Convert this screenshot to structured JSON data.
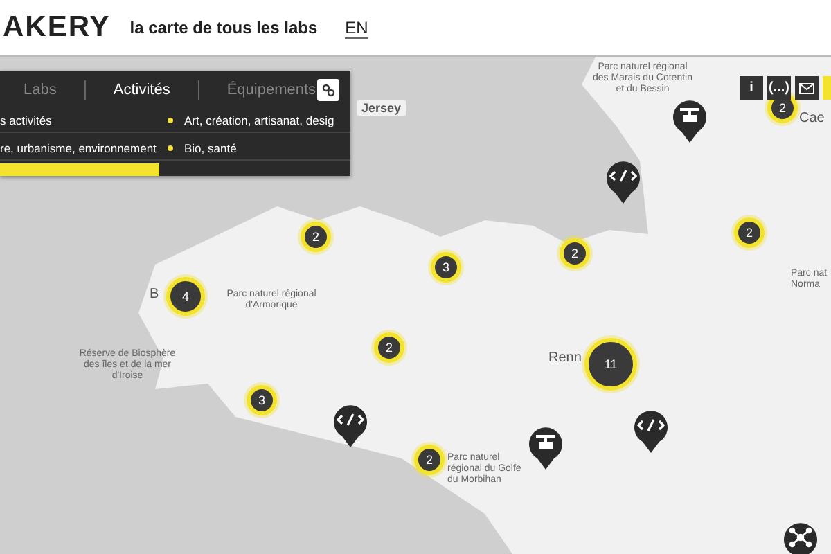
{
  "header": {
    "logo": "AKERY",
    "tagline": "la carte de tous les labs",
    "language": "EN"
  },
  "panel": {
    "tabs": [
      {
        "label": "Labs",
        "selected": false
      },
      {
        "label": "Activités",
        "selected": true
      },
      {
        "label": "Équipements",
        "selected": false
      }
    ],
    "filters": [
      {
        "label": "s activités",
        "dot": false
      },
      {
        "label": "Art, création, artisanat, desig",
        "dot": true
      },
      {
        "label": "re, urbanisme, environnement",
        "dot": false
      },
      {
        "label": "Bio, santé",
        "dot": true
      }
    ]
  },
  "map_tools": [
    {
      "kind": "text",
      "label": "i"
    },
    {
      "kind": "text",
      "label": "(...)"
    },
    {
      "kind": "mail"
    },
    {
      "kind": "blank"
    }
  ],
  "map_labels": [
    {
      "text": "Parc naturel régional des Marais du Cotentin et du Bessin"
    },
    {
      "text": "Jersey"
    },
    {
      "text": "Cae"
    },
    {
      "text": "Parc nat Norma"
    },
    {
      "text": "B"
    },
    {
      "text": "Parc naturel régional d'Armorique"
    },
    {
      "text": "Renn"
    },
    {
      "text": "Réserve de Biosphère des îles et de la mer d'Iroise"
    },
    {
      "text": "Parc naturel régional du Golfe du Morbihan"
    }
  ],
  "clusters": [
    {
      "count": "2"
    },
    {
      "count": "2"
    },
    {
      "count": "3"
    },
    {
      "count": "2"
    },
    {
      "count": "2"
    },
    {
      "count": "4"
    },
    {
      "count": "2"
    },
    {
      "count": "11"
    },
    {
      "count": "3"
    },
    {
      "count": "2"
    }
  ],
  "pins": [
    {
      "kind": "printer"
    },
    {
      "kind": "code"
    },
    {
      "kind": "code"
    },
    {
      "kind": "printer"
    },
    {
      "kind": "code"
    },
    {
      "kind": "network"
    }
  ]
}
